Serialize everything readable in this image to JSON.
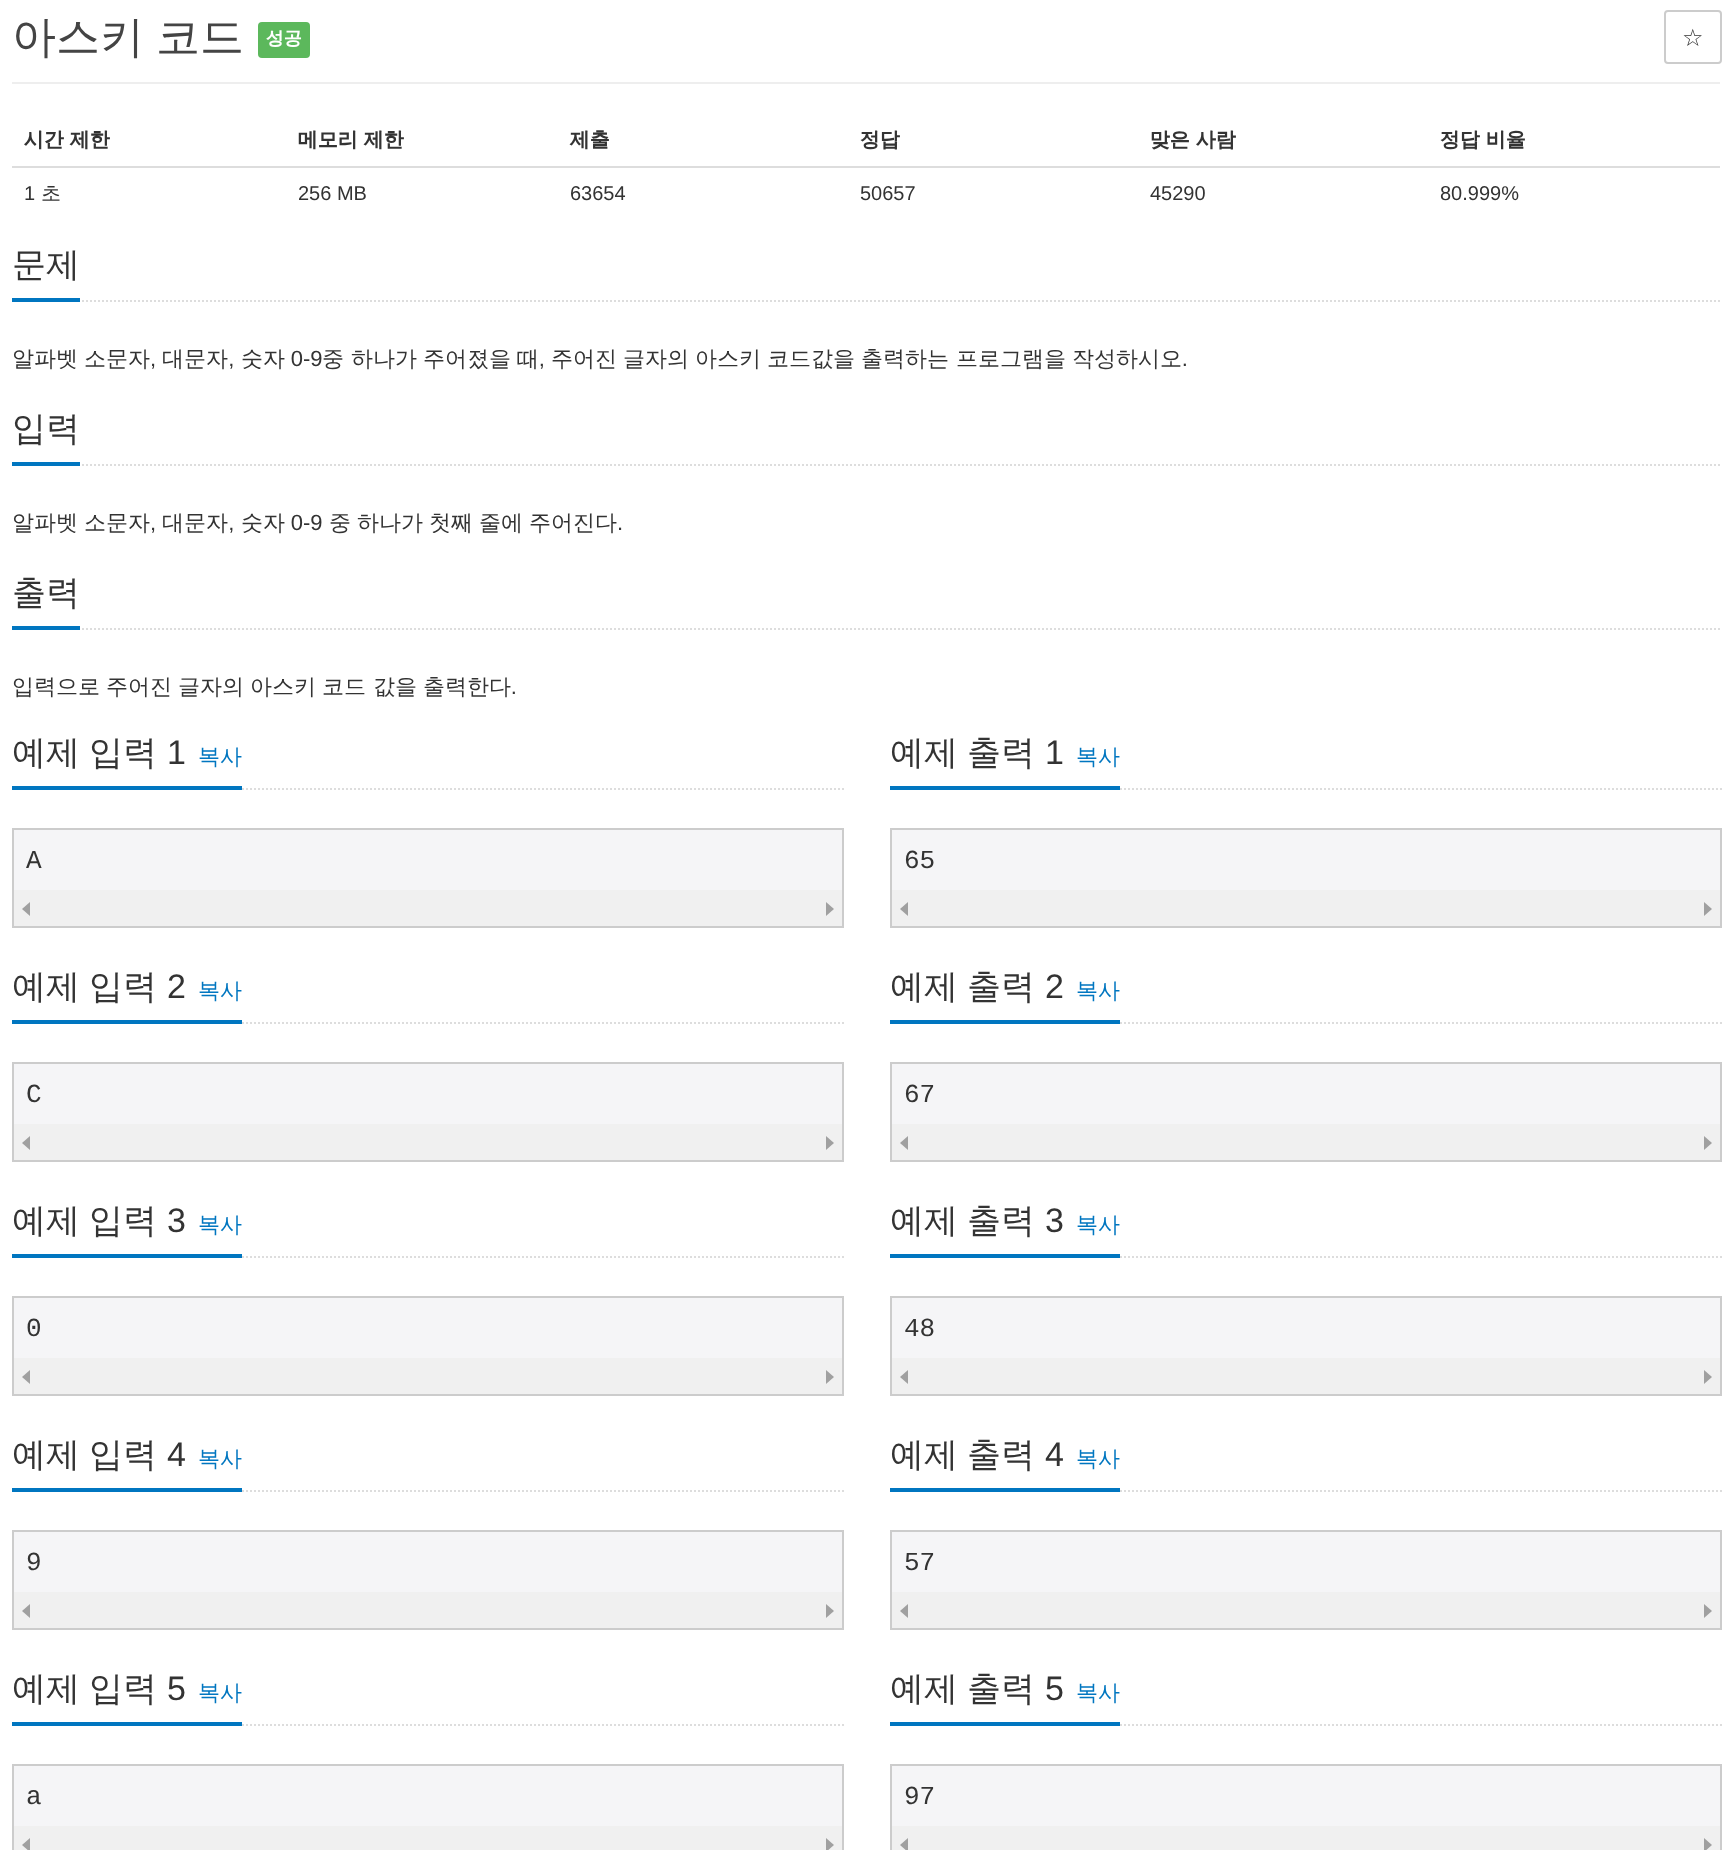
{
  "title": "아스키 코드",
  "badge": "성공",
  "star_button": "☆",
  "info_table": {
    "columns": [
      "시간 제한",
      "메모리 제한",
      "제출",
      "정답",
      "맞은 사람",
      "정답 비율"
    ],
    "rows": [
      [
        "1 초",
        "256 MB",
        "63654",
        "50657",
        "45290",
        "80.999%"
      ]
    ]
  },
  "sections": [
    {
      "heading": "문제",
      "text": "알파벳 소문자, 대문자, 숫자 0-9중 하나가 주어졌을 때, 주어진 글자의 아스키 코드값을 출력하는 프로그램을 작성하시오."
    },
    {
      "heading": "입력",
      "text": "알파벳 소문자, 대문자, 숫자 0-9 중 하나가 첫째 줄에 주어진다."
    },
    {
      "heading": "출력",
      "text": "입력으로 주어진 글자의 아스키 코드 값을 출력한다."
    }
  ],
  "examples": [
    {
      "input": {
        "heading": "예제 입력 1",
        "copy": "복사",
        "value": "A"
      },
      "output": {
        "heading": "예제 출력 1",
        "copy": "복사",
        "value": "65"
      }
    },
    {
      "input": {
        "heading": "예제 입력 2",
        "copy": "복사",
        "value": "C"
      },
      "output": {
        "heading": "예제 출력 2",
        "copy": "복사",
        "value": "67"
      }
    },
    {
      "input": {
        "heading": "예제 입력 3",
        "copy": "복사",
        "value": "0"
      },
      "output": {
        "heading": "예제 출력 3",
        "copy": "복사",
        "value": "48"
      }
    },
    {
      "input": {
        "heading": "예제 입력 4",
        "copy": "복사",
        "value": "9"
      },
      "output": {
        "heading": "예제 출력 4",
        "copy": "복사",
        "value": "57"
      }
    },
    {
      "input": {
        "heading": "예제 입력 5",
        "copy": "복사",
        "value": "a"
      },
      "output": {
        "heading": "예제 출력 5",
        "copy": "복사",
        "value": "97"
      }
    }
  ]
}
